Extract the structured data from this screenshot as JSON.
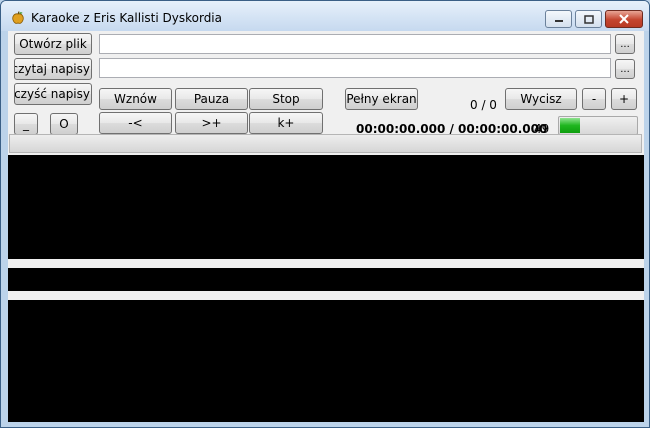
{
  "window": {
    "title": "Karaoke z Eris Kallisti Dyskordia",
    "icon": "golden-apple-icon"
  },
  "file_row": {
    "open_label": "Otwórz plik",
    "path_value": "",
    "browse_label": "..."
  },
  "subtitle_row": {
    "load_label": "Wczytaj napisy",
    "path_value": "",
    "browse_label": "..."
  },
  "controls": {
    "clear_label": "Wyczyść napisy",
    "minimize_label": "_",
    "restore_label": "O",
    "resume_label": "Wznów",
    "pause_label": "Pauza",
    "stop_label": "Stop",
    "back_label": "-<",
    "forward_label": ">+",
    "k_plus_label": "k+",
    "fullscreen_label": "Pełny ekran",
    "counter": "0 / 0",
    "time": "00:00:00.000 / 00:00:00.000",
    "mute_label": "Wycisz",
    "vol_down_label": "-",
    "vol_up_label": "+",
    "volume_value": "49",
    "volume_fraction": 0.25
  },
  "seek": {
    "progress": 0
  },
  "colors": {
    "panel_bg": "#000000",
    "frame_bg": "#bcd3ea",
    "volume_fill": "#1fb61f"
  }
}
